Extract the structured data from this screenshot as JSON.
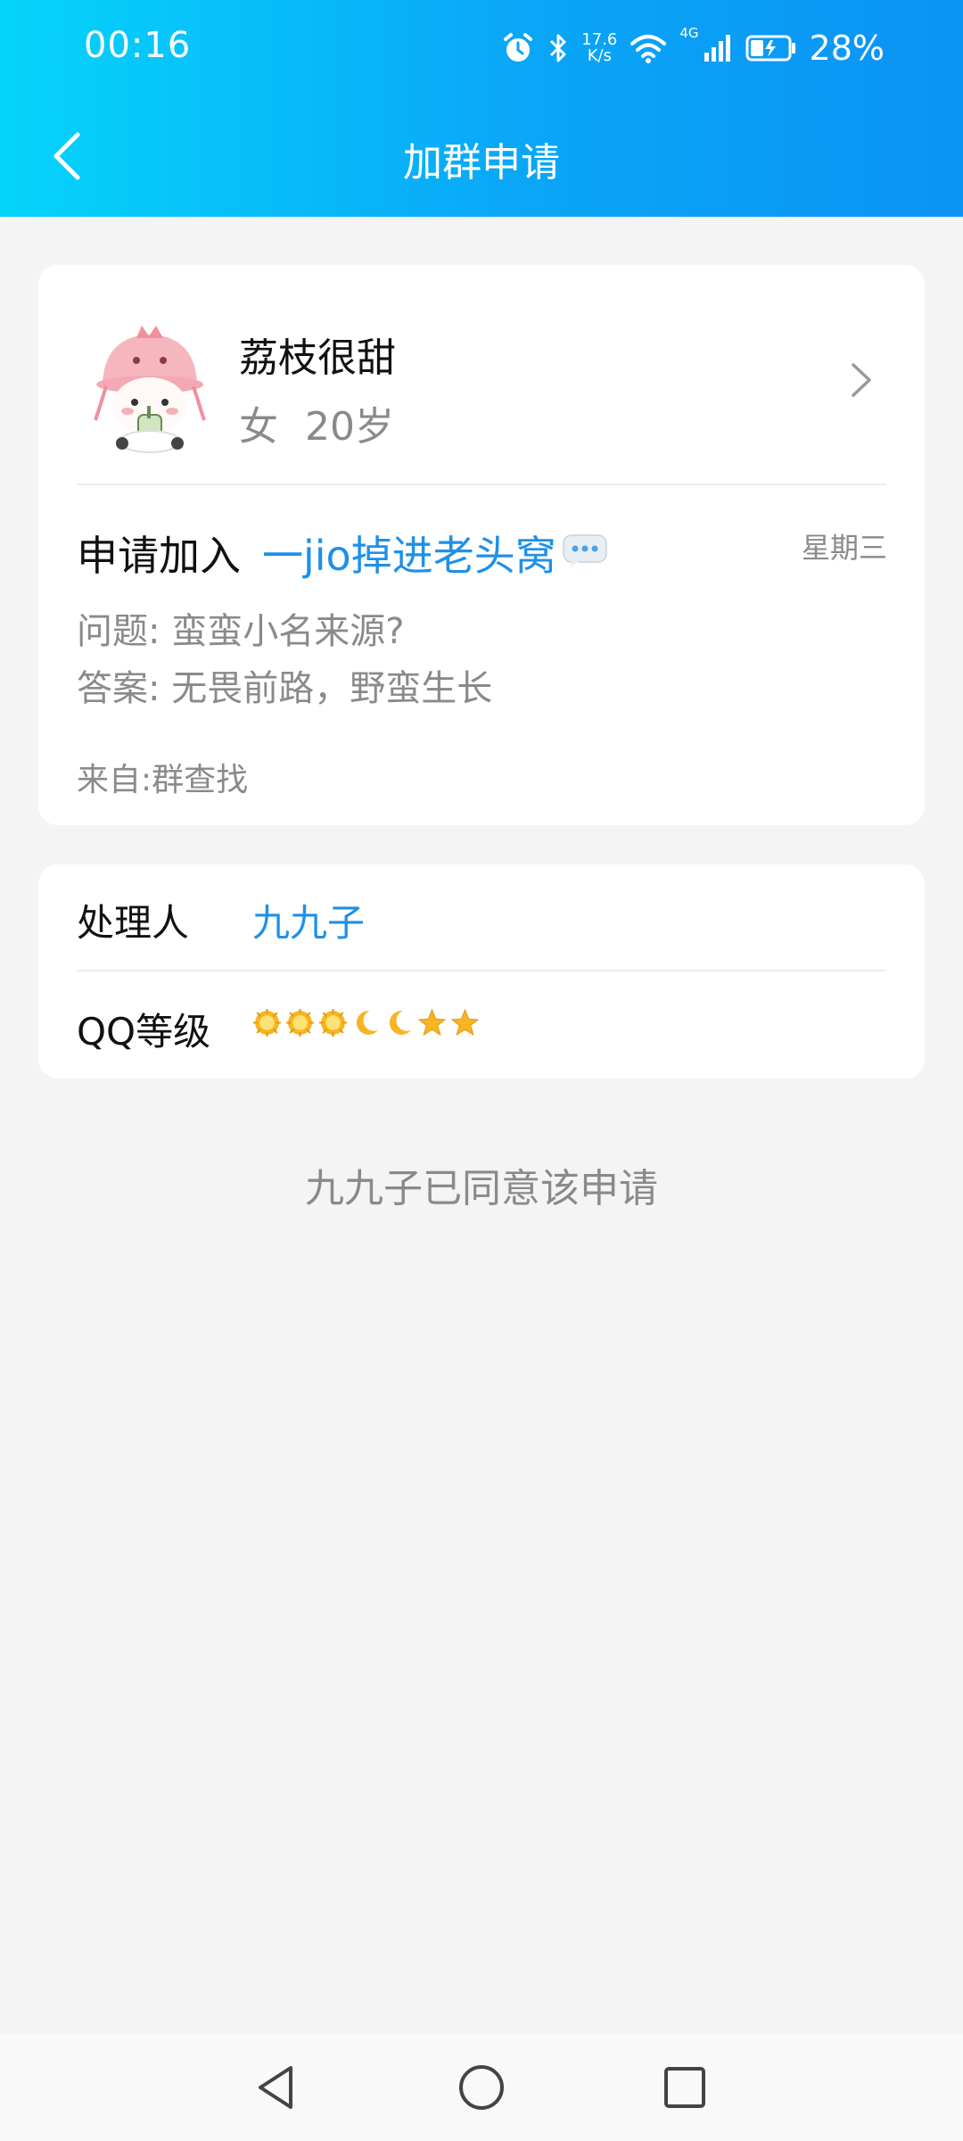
{
  "status_bar": {
    "time": "00:16",
    "net_speed_value": "17.6",
    "net_speed_unit": "K/s",
    "network_type": "4G",
    "battery_percent": "28%",
    "icons": [
      "alarm-icon",
      "bluetooth-icon",
      "wifi-icon",
      "signal-icon",
      "battery-charging-icon"
    ]
  },
  "header": {
    "title": "加群申请",
    "back_icon": "back-chevron-icon"
  },
  "applicant": {
    "name": "荔枝很甜",
    "gender": "女",
    "age": "20岁",
    "avatar_icon": "cartoon-avatar"
  },
  "request": {
    "label": "申请加入",
    "group_name": "一jio掉进老头窝",
    "weekday": "星期三",
    "question": "问题:  蛮蛮小名来源?",
    "answer": "答案:  无畏前路，野蛮生长",
    "source": "来自:群查找"
  },
  "details": {
    "handler_label": "处理人",
    "handler_name": "九九子",
    "level_label": "QQ等级",
    "level_icons": [
      "sun-icon",
      "sun-icon",
      "sun-icon",
      "moon-icon",
      "moon-icon",
      "star-icon",
      "star-icon"
    ]
  },
  "result_message": "九九子已同意该申请",
  "colors": {
    "header_gradient_start": "#05d4fb",
    "header_gradient_end": "#0b93f5",
    "link_blue": "#1e90e8",
    "background": "#f4f4f4"
  }
}
